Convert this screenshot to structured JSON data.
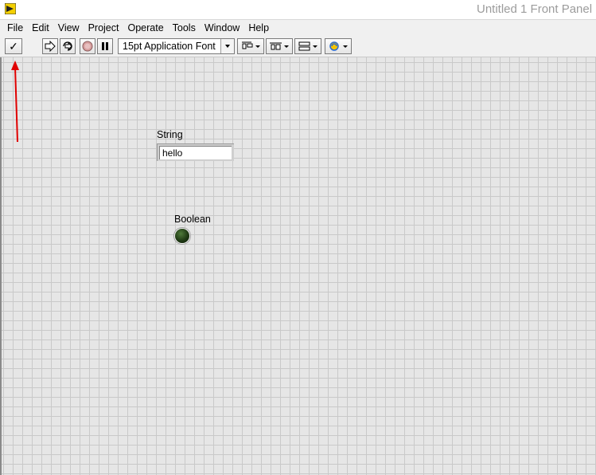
{
  "window": {
    "title": "Untitled 1 Front Panel"
  },
  "menu": {
    "items": [
      "File",
      "Edit",
      "View",
      "Project",
      "Operate",
      "Tools",
      "Window",
      "Help"
    ]
  },
  "toolbar": {
    "run_glyph": "✓",
    "font_value": "15pt Application Font",
    "icons": [
      "run-icon",
      "run-continuously-icon",
      "abort-icon",
      "pause-icon",
      "text-settings-icon",
      "align-objects-icon",
      "distribute-objects-icon",
      "resize-objects-icon",
      "reorder-icon"
    ]
  },
  "panel": {
    "string_control": {
      "label": "String",
      "value": "hello"
    },
    "boolean_indicator": {
      "label": "Boolean",
      "state": "off"
    }
  },
  "colors": {
    "annotation_arrow": "#e00000",
    "led_off": "#1f3a14"
  }
}
